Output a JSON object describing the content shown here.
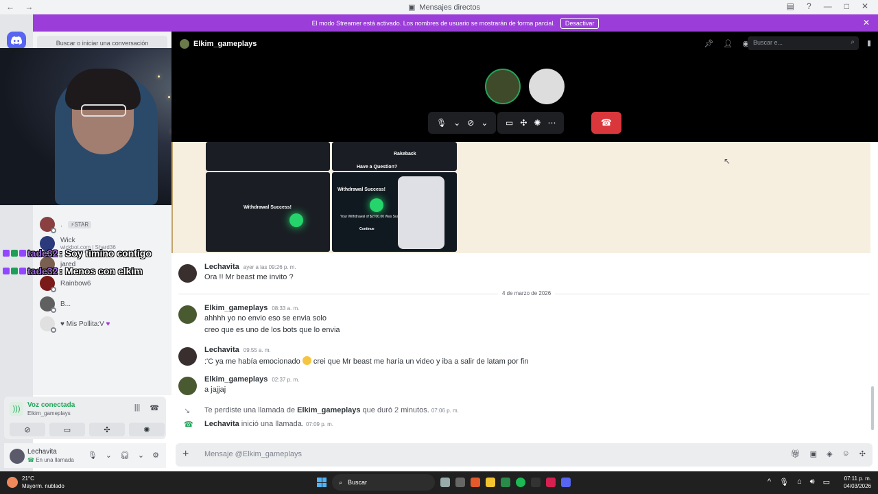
{
  "window": {
    "title": "Mensajes directos",
    "nav": "← →"
  },
  "banner": {
    "text": "El modo Streamer está activado. Los nombres de usuario se mostrarán de forma parcial.",
    "button": "Desactivar"
  },
  "dm_search": {
    "label": "Buscar o iniciar una conversación"
  },
  "dm_items": [
    {
      "name": ".",
      "badge": "STAR",
      "color": "#8a4040"
    },
    {
      "name": "Wick",
      "sub": "wickbot.com | Shard36",
      "color": "#2a3a7a"
    },
    {
      "name": "jared",
      "color": "#7a6050"
    },
    {
      "name": "Rainbow6",
      "color": "#7a1a1a"
    },
    {
      "name": "B...",
      "color": "#606060"
    },
    {
      "name": "Mis Pollita:V",
      "color": "#e0e0e0"
    }
  ],
  "overlay_chat": [
    {
      "user": "tade32",
      "text": ": Soy timino contigo"
    },
    {
      "user": "tade32",
      "text": ": Menos con elkim"
    }
  ],
  "voice_panel": {
    "title": "Voz conectada",
    "sub": "Elkim_gameplays"
  },
  "user_panel": {
    "name": "Lechavita",
    "status": "En una llamada"
  },
  "call": {
    "channel_name": "Elkim_gameplays",
    "search_placeholder": "Buscar e..."
  },
  "messages": [
    {
      "author": "Lechavita",
      "time": "ayer a las 09:26 p. m.",
      "lines": [
        "Ora !! Mr beast me invito ?"
      ]
    },
    {
      "author": "Elkim_gameplays",
      "time": "08:33 a. m.",
      "lines": [
        "ahhhh yo no envio eso se envia solo",
        "creo que es uno de los bots que lo envia"
      ]
    },
    {
      "author": "Lechavita",
      "time": "09:55 a. m.",
      "lines_pre": ":'C ya me había emocionado",
      "lines_post": "crei que Mr beast me haría un video y iba a salir de latam por fin"
    },
    {
      "author": "Elkim_gameplays",
      "time": "02:37 p. m.",
      "lines": [
        "a jajjaj"
      ]
    }
  ],
  "date_divider": "4 de marzo de 2026",
  "system": [
    {
      "pre": "Te perdiste una llamada de ",
      "bold": "Elkim_gameplays",
      "post": " que duró 2 minutos.",
      "time": "07:06 p. m."
    },
    {
      "bold": "Lechavita",
      "post": " inició una llamada.",
      "time": "07:09 p. m."
    }
  ],
  "embed_images": {
    "withdrawal_title": "Withdrawal Success!",
    "withdrawal_text": "Your Withdrawal of $2700.00 Was Successfully!",
    "continue": "Continue",
    "rakeback": "Rakeback",
    "question": "Have a Question?"
  },
  "composer": {
    "placeholder": "Mensaje @Elkim_gameplays"
  },
  "taskbar": {
    "temp": "21°C",
    "weather": "Mayorm. nublado",
    "search": "Buscar",
    "time": "07:11 p. m.",
    "date": "04/03/2026"
  },
  "colors": {
    "brand": "#5865f2",
    "streamer_banner": "#9b3dd9",
    "hangup": "#da373c",
    "connected": "#23a55a"
  }
}
